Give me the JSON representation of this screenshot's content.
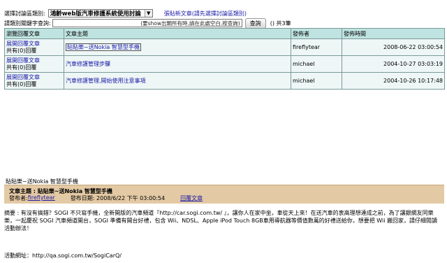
{
  "filter": {
    "category_label": "選擇討論區類別:",
    "category_value": "鴻齡web版汽車修護系統使用討論",
    "post_new": "張貼新文章(請先選擇討論區類別)",
    "search_label": "請類別關鍵字查詢:",
    "search_value": "(要show出類所有時,請在此處空白,按查詢)",
    "search_button": "查詢",
    "result_count": "() 共3筆"
  },
  "table": {
    "headers": [
      "瀏覽回覆文章",
      "文章主題",
      "發佈者",
      "發佈時間"
    ],
    "rows": [
      {
        "expand": "展開回覆文章",
        "replies": "共有(0)回覆",
        "subject": "貼貼樂~送Nokia 智慧型手機",
        "author": "fireflytear",
        "date": "2008-06-22 03:00:54"
      },
      {
        "expand": "展開回覆文章",
        "replies": "共有(0)回覆",
        "subject": "汽車修護管理步驟",
        "author": "michael",
        "date": "2004-10-27 03:03:19"
      },
      {
        "expand": "展開回覆文章",
        "replies": "共有(0)回覆",
        "subject": "汽車修護管理,開始使用注意事項",
        "author": "michael",
        "date": "2004-10-26 10:17:48"
      }
    ]
  },
  "detail": {
    "prelabel": "貼貼樂~送Nokia 智慧型手機",
    "title": "文章主題 : 貼貼樂~送Nokia 智慧型手機",
    "author_label": "發布者:",
    "author": "fireflytear",
    "date_label": "發布日期: 2008/6/22 下午 03:00:54",
    "reply": "回覆文章",
    "summary": "摘要 : 有沒有搞錯？SOGI 不只寫手機，全新開版的汽車頻道『http://car.sogi.com.tw/ 』，讓你人在家中坐，車從天上來！在送汽車的衷高理想達成之前，為了讓銀網友同樂樂，一起慶祝 SOGI 汽車頻道開台，SOGI 準備有開台好禮，包含 Wii、NDSL、Apple iPod Touch 8GB車用導航器等價值數萬的好禮送給你，想要把 Wii 搬回家，請仔細閱讀活動辦法！",
    "site": "活動網址：http://qa.sogi.com.tw/SogiCarQ/"
  }
}
